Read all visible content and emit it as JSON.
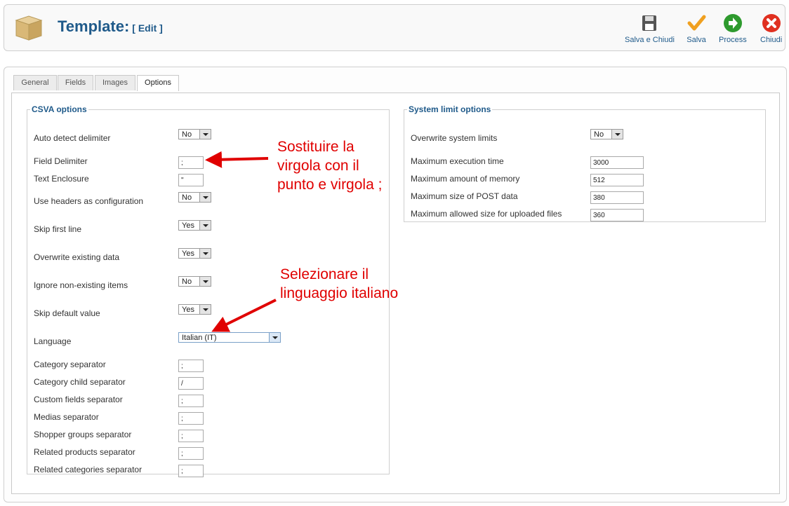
{
  "header": {
    "title": "Template:",
    "subtitle": "[ Edit ]",
    "buttons": [
      {
        "label": "Salva e Chiudi",
        "icon": "save-icon"
      },
      {
        "label": "Salva",
        "icon": "checkmark-icon"
      },
      {
        "label": "Process",
        "icon": "process-arrow-icon"
      },
      {
        "label": "Chiudi",
        "icon": "close-icon"
      }
    ]
  },
  "tabs": [
    "General",
    "Fields",
    "Images",
    "Options"
  ],
  "active_tab": "Options",
  "csva": {
    "legend": "CSVA options",
    "auto_detect_delimiter": {
      "label": "Auto detect delimiter",
      "value": "No"
    },
    "field_delimiter": {
      "label": "Field Delimiter",
      "value": ";"
    },
    "text_enclosure": {
      "label": "Text Enclosure",
      "value": "\""
    },
    "use_headers": {
      "label": "Use headers as configuration",
      "value": "No"
    },
    "skip_first_line": {
      "label": "Skip first line",
      "value": "Yes"
    },
    "overwrite_existing": {
      "label": "Overwrite existing data",
      "value": "Yes"
    },
    "ignore_non_existing": {
      "label": "Ignore non-existing items",
      "value": "No"
    },
    "skip_default": {
      "label": "Skip default value",
      "value": "Yes"
    },
    "language": {
      "label": "Language",
      "value": "Italian (IT)"
    },
    "category_separator": {
      "label": "Category separator",
      "value": ";"
    },
    "category_child_separator": {
      "label": "Category child separator",
      "value": "/"
    },
    "custom_fields_separator": {
      "label": "Custom fields separator",
      "value": ";"
    },
    "medias_separator": {
      "label": "Medias separator",
      "value": ";"
    },
    "shopper_groups_separator": {
      "label": "Shopper groups separator",
      "value": ";"
    },
    "related_products_separator": {
      "label": "Related products separator",
      "value": ";"
    },
    "related_categories_separator": {
      "label": "Related categories separator",
      "value": ";"
    }
  },
  "system": {
    "legend": "System limit options",
    "overwrite_limits": {
      "label": "Overwrite system limits",
      "value": "No"
    },
    "max_execution_time": {
      "label": "Maximum execution time",
      "value": "3000"
    },
    "max_memory": {
      "label": "Maximum amount of memory",
      "value": "512"
    },
    "max_post": {
      "label": "Maximum size of POST data",
      "value": "380"
    },
    "max_upload": {
      "label": "Maximum allowed size for uploaded files",
      "value": "360"
    }
  },
  "annotations": {
    "note1": [
      "Sostituire la",
      "virgola con il",
      "punto e virgola ;"
    ],
    "note2": [
      "Selezionare il",
      "linguaggio italiano"
    ]
  },
  "colors": {
    "title": "#1f5a8a",
    "annotation": "#e00000",
    "save": "#f0a020",
    "process": "#2e9a2e",
    "close": "#e03020"
  }
}
